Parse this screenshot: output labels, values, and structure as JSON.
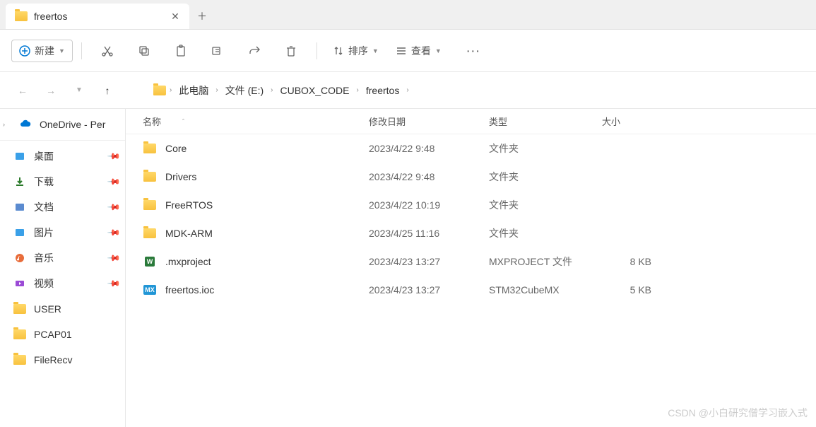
{
  "tab": {
    "title": "freertos"
  },
  "toolbar": {
    "new_label": "新建",
    "sort_label": "排序",
    "view_label": "查看"
  },
  "breadcrumb": {
    "items": [
      "此电脑",
      "文件 (E:)",
      "CUBOX_CODE",
      "freertos"
    ]
  },
  "sidebar": {
    "onedrive": "OneDrive - Per",
    "quick": [
      {
        "label": "桌面",
        "pinned": true,
        "color": "#3aa0e8"
      },
      {
        "label": "下载",
        "pinned": true,
        "color": "#2b7a2b"
      },
      {
        "label": "文档",
        "pinned": true,
        "color": "#5b8bd0"
      },
      {
        "label": "图片",
        "pinned": true,
        "color": "#3aa0e8"
      },
      {
        "label": "音乐",
        "pinned": true,
        "color": "#e86c3a"
      },
      {
        "label": "视频",
        "pinned": true,
        "color": "#9b4ad6"
      },
      {
        "label": "USER",
        "pinned": false,
        "folder": true
      },
      {
        "label": "PCAP01",
        "pinned": false,
        "folder": true
      },
      {
        "label": "FileRecv",
        "pinned": false,
        "folder": true
      }
    ]
  },
  "columns": {
    "name": "名称",
    "date": "修改日期",
    "type": "类型",
    "size": "大小"
  },
  "files": [
    {
      "name": "Core",
      "date": "2023/4/22 9:48",
      "type": "文件夹",
      "size": "",
      "icon": "folder"
    },
    {
      "name": "Drivers",
      "date": "2023/4/22 9:48",
      "type": "文件夹",
      "size": "",
      "icon": "folder"
    },
    {
      "name": "FreeRTOS",
      "date": "2023/4/22 10:19",
      "type": "文件夹",
      "size": "",
      "icon": "folder"
    },
    {
      "name": "MDK-ARM",
      "date": "2023/4/25 11:16",
      "type": "文件夹",
      "size": "",
      "icon": "folder"
    },
    {
      "name": ".mxproject",
      "date": "2023/4/23 13:27",
      "type": "MXPROJECT 文件",
      "size": "8 KB",
      "icon": "mxproj"
    },
    {
      "name": "freertos.ioc",
      "date": "2023/4/23 13:27",
      "type": "STM32CubeMX",
      "size": "5 KB",
      "icon": "mx"
    }
  ],
  "watermark": "CSDN @小白研究僧学习嵌入式"
}
